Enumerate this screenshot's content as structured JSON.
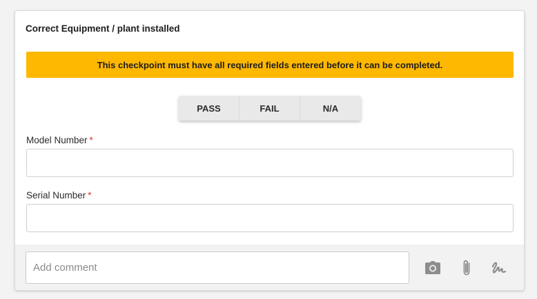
{
  "checkpoint": {
    "title": "Correct Equipment / plant installed",
    "warning": "This checkpoint must have all required fields entered before it can be completed."
  },
  "result_options": [
    "PASS",
    "FAIL",
    "N/A"
  ],
  "fields": [
    {
      "label": "Model Number",
      "required_mark": "*",
      "value": ""
    },
    {
      "label": "Serial Number",
      "required_mark": "*",
      "value": ""
    }
  ],
  "footer": {
    "comment_placeholder": "Add comment",
    "icons": [
      "camera-icon",
      "paperclip-icon",
      "signature-icon"
    ]
  },
  "colors": {
    "warning_bg": "#ffb800",
    "required": "#d9342b",
    "icon": "#8d8d8d"
  }
}
